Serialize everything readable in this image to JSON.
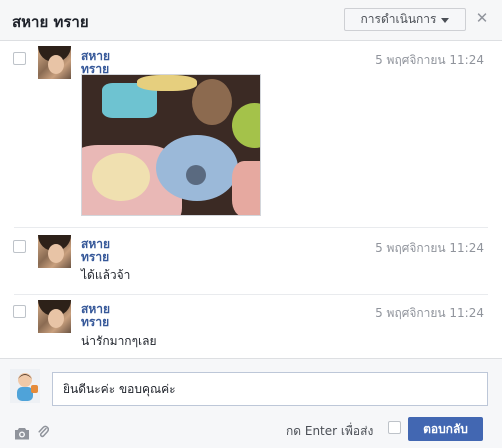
{
  "header": {
    "title": "สหาย ทราย",
    "actions_label": "การดำเนินการ",
    "close_glyph": "✕"
  },
  "messages": [
    {
      "sender": "สหาย ทราย",
      "time": "5 พฤศจิกายน 11:24",
      "text": "",
      "has_photo": true
    },
    {
      "sender": "สหาย ทราย",
      "time": "5 พฤศจิกายน 11:24",
      "text": "ได้แล้วจ้า"
    },
    {
      "sender": "สหาย ทราย",
      "time": "5 พฤศจิกายน 11:24",
      "text": "น่ารักมากๆเลย"
    }
  ],
  "composer": {
    "input_value": "ยินดีนะค่ะ ขอบคุณค่ะ",
    "enter_to_send_label": "กด Enter เพื่อส่ง",
    "enter_to_send_checked": false,
    "reply_button_label": "ตอบกลับ"
  },
  "colors": {
    "link": "#365899",
    "button": "#4267b2",
    "header_bg": "#f6f7f8",
    "timestamp": "#90949c"
  },
  "icons": [
    "caret-down-icon",
    "close-icon",
    "camera-icon",
    "paperclip-icon"
  ]
}
